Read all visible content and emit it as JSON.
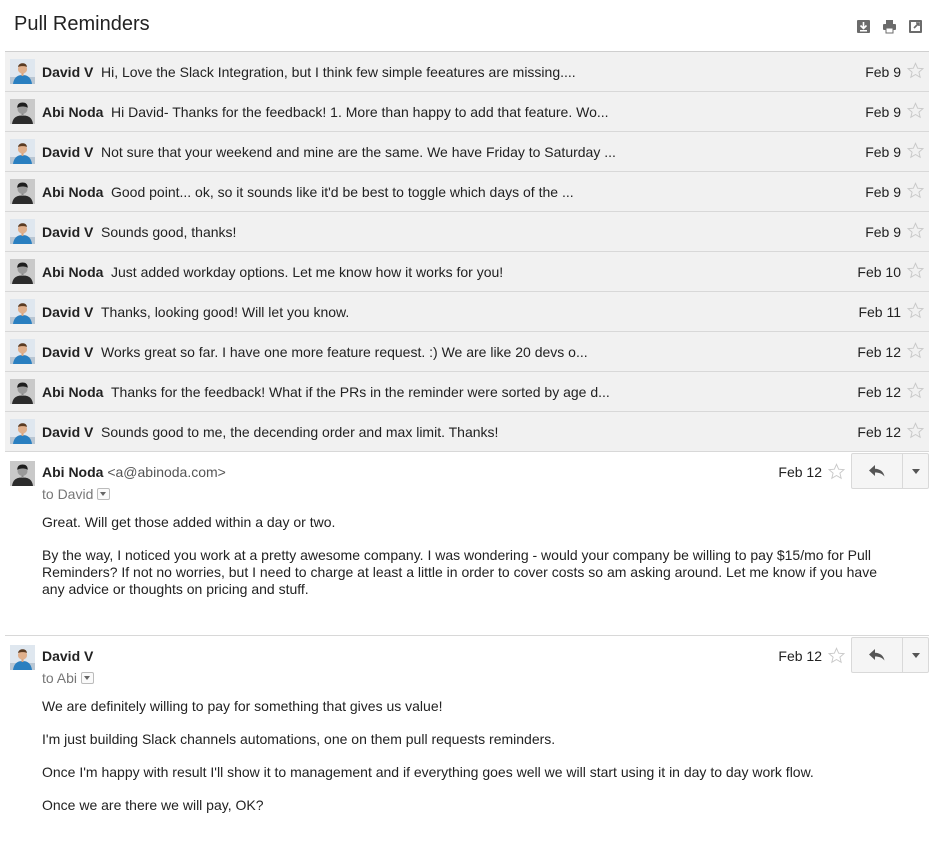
{
  "thread": {
    "subject": "Pull Reminders",
    "icons": [
      "download-icon",
      "print-icon",
      "new-window-icon"
    ]
  },
  "collapsed": [
    {
      "sender": "David V",
      "avatar": "david",
      "snippet": "Hi, Love the Slack Integration, but I think few simple feeatures are missing....",
      "date": "Feb 9"
    },
    {
      "sender": "Abi Noda",
      "avatar": "abi",
      "snippet": "Hi David- Thanks for the feedback! 1. More than happy to add that feature. Wo...",
      "date": "Feb 9"
    },
    {
      "sender": "David V",
      "avatar": "david",
      "snippet": "Not sure that your weekend and mine are the same. We have Friday to Saturday ...",
      "date": "Feb 9"
    },
    {
      "sender": "Abi Noda",
      "avatar": "abi",
      "snippet": "Good point... ok, so it sounds like it'd be best to toggle which days of the ...",
      "date": "Feb 9"
    },
    {
      "sender": "David V",
      "avatar": "david",
      "snippet": "Sounds good, thanks!",
      "date": "Feb 9"
    },
    {
      "sender": "Abi Noda",
      "avatar": "abi",
      "snippet": "Just added workday options. Let me know how it works for you!",
      "date": "Feb 10"
    },
    {
      "sender": "David V",
      "avatar": "david",
      "snippet": "Thanks, looking good! Will let you know.",
      "date": "Feb 11"
    },
    {
      "sender": "David V",
      "avatar": "david",
      "snippet": "Works great so far. I have one more feature request. :) We are like 20 devs o...",
      "date": "Feb 12"
    },
    {
      "sender": "Abi Noda",
      "avatar": "abi",
      "snippet": "Thanks for the feedback! What if the PRs in the reminder were sorted by age d...",
      "date": "Feb 12"
    },
    {
      "sender": "David V",
      "avatar": "david",
      "snippet": "Sounds good to me, the decending order and max limit. Thanks!",
      "date": "Feb 12"
    }
  ],
  "messages": [
    {
      "sender": "Abi Noda",
      "email": "<a@abinoda.com>",
      "to": "to David",
      "date": "Feb 12",
      "paragraphs": [
        "Great. Will get those added within a day or two.",
        "By the way, I noticed you work at a pretty awesome company. I was wondering - would your company be willing to pay $15/mo for Pull Reminders? If not no worries, but I need to charge at least a little in order to cover costs so am asking around. Let me know if you have any advice or thoughts on pricing and stuff."
      ]
    },
    {
      "sender": "David V",
      "email": "",
      "to": "to Abi",
      "date": "Feb 12",
      "paragraphs": [
        "We are definitely willing to pay for something that gives us value!",
        "I'm just building Slack channels automations, one on them pull requests reminders.",
        "Once I'm happy with result I'll show it to management and if everything goes well we will start using it in day to day work flow.",
        "Once we are there we will pay, OK?"
      ]
    }
  ],
  "colors": {
    "row_bg": "#f1f1f1",
    "divider": "#d8d8d8",
    "david_shirt": "#2a7fc0",
    "star": "#c8c8c8"
  }
}
